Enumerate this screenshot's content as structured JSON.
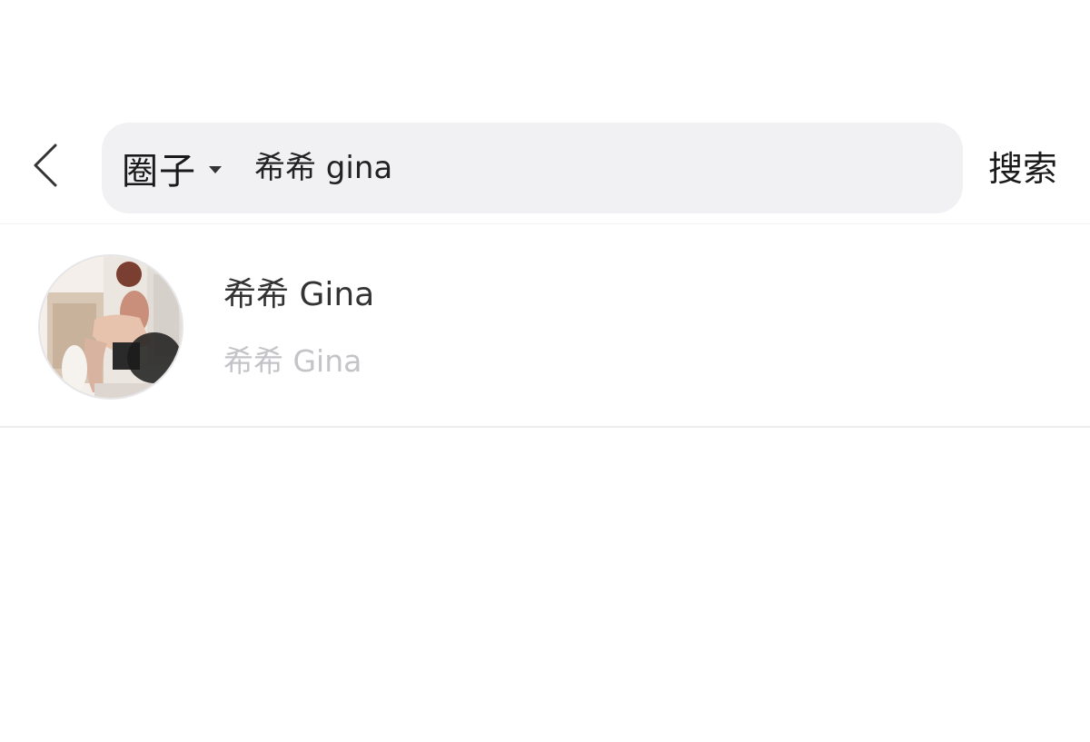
{
  "header": {
    "back_icon": "chevron-left-icon",
    "scope_label": "圈子",
    "scope_dropdown_icon": "caret-down-icon",
    "search_query": "希希 gina",
    "search_button_label": "搜索"
  },
  "results": [
    {
      "title": "希希 Gina",
      "subtitle": "希希 Gina"
    }
  ],
  "colors": {
    "search_box_bg": "#f1f1f4",
    "title_text": "#333333",
    "subtitle_text": "#c4c4c8",
    "divider": "#ececef"
  }
}
